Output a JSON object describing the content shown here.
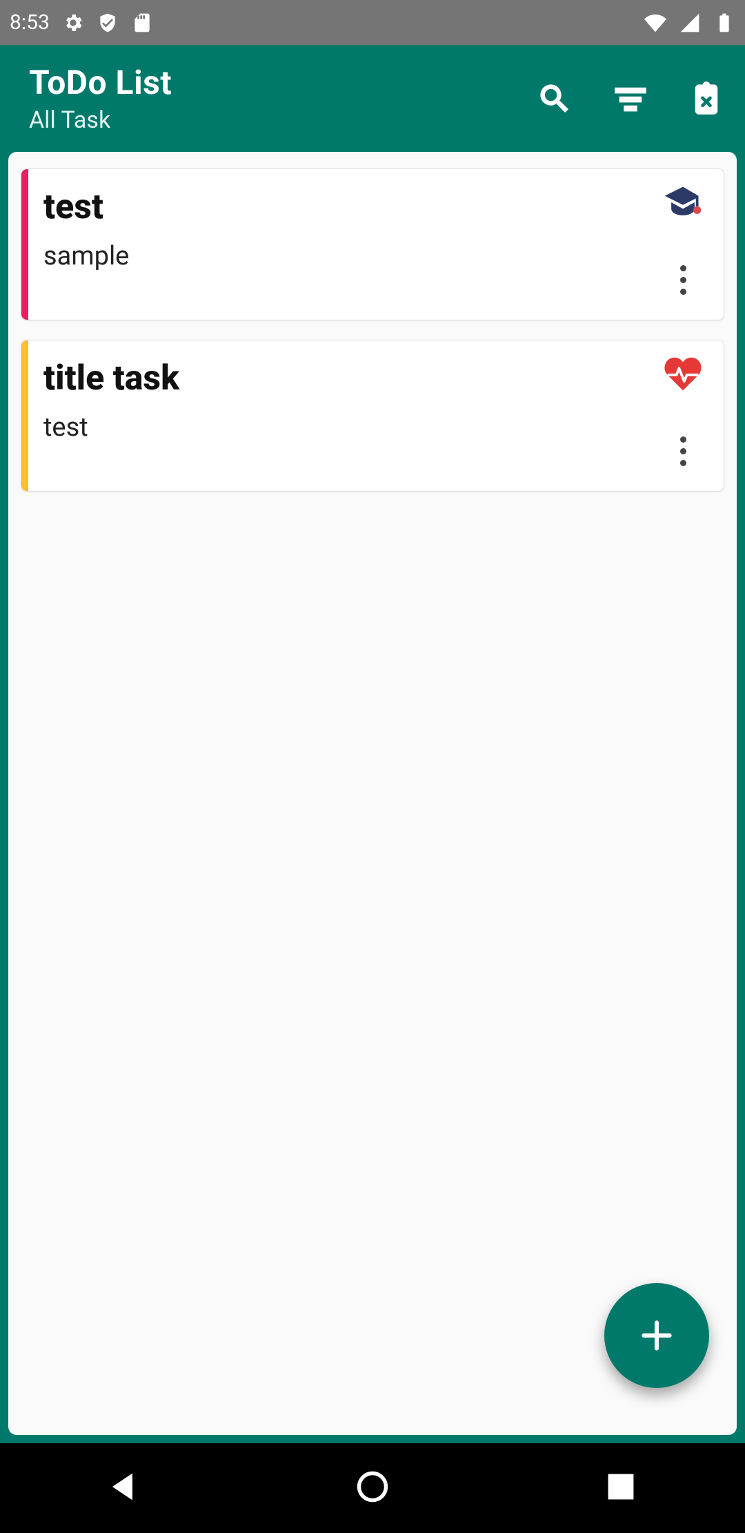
{
  "status": {
    "time": "8:53"
  },
  "appbar": {
    "title": "ToDo List",
    "subtitle": "All Task"
  },
  "tasks": [
    {
      "title": "test",
      "note": "sample",
      "stripe": "#e91e63",
      "category": "education"
    },
    {
      "title": "title task",
      "note": "test",
      "stripe": "#fbc02d",
      "category": "health"
    }
  ],
  "colors": {
    "primary": "#00796b",
    "status_bg": "#757575"
  }
}
